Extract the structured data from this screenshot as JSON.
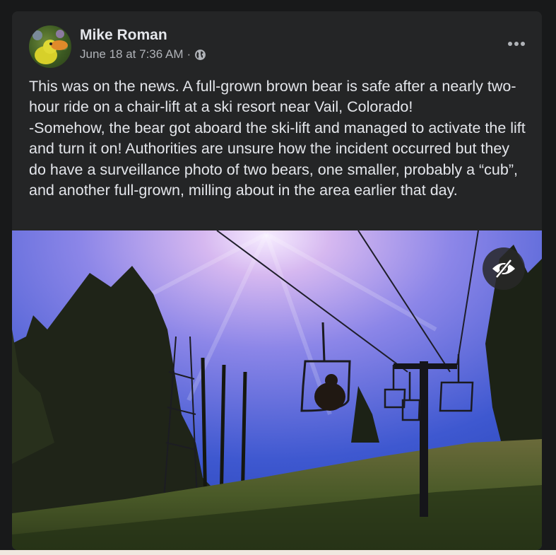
{
  "post": {
    "author": "Mike Roman",
    "timestamp": "June 18 at 7:36 AM",
    "separator": "·",
    "privacy_icon": "globe-icon",
    "more_icon": "more-options-icon",
    "text": "This was on the news.  A full-grown brown bear is safe after a nearly two-hour ride on a chair-lift at a ski resort near Vail, Colorado!\n-Somehow, the bear got aboard the ski-lift and managed to activate the lift and turn it on!   Authorities are unsure how the incident occurred but they do have a surveillance photo of two bears, one smaller, probably a “cub”, and another full-grown, milling about in the area earlier that day.",
    "photo_overlay_icon": "eye-slash-icon"
  },
  "colors": {
    "page_background": "#18191a",
    "card_background": "#242526",
    "primary_text": "#e4e6eb",
    "secondary_text": "#b0b3b8"
  }
}
